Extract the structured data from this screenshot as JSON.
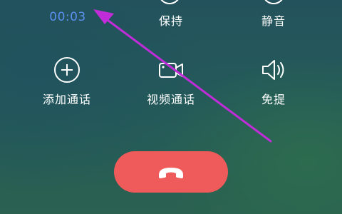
{
  "call": {
    "duration": "00:03"
  },
  "controls": {
    "hold": "保持",
    "mute": "静音",
    "add_call": "添加通话",
    "video_call": "视频通话",
    "speaker": "免提"
  },
  "icons": {
    "add": "plus-circle-icon",
    "video": "video-camera-icon",
    "speaker": "speaker-icon",
    "hangup": "phone-hangup-icon"
  },
  "colors": {
    "timer": "#5a8ff0",
    "hangup": "#ef5a5a",
    "annotation_arrow": "#c02cd8"
  }
}
